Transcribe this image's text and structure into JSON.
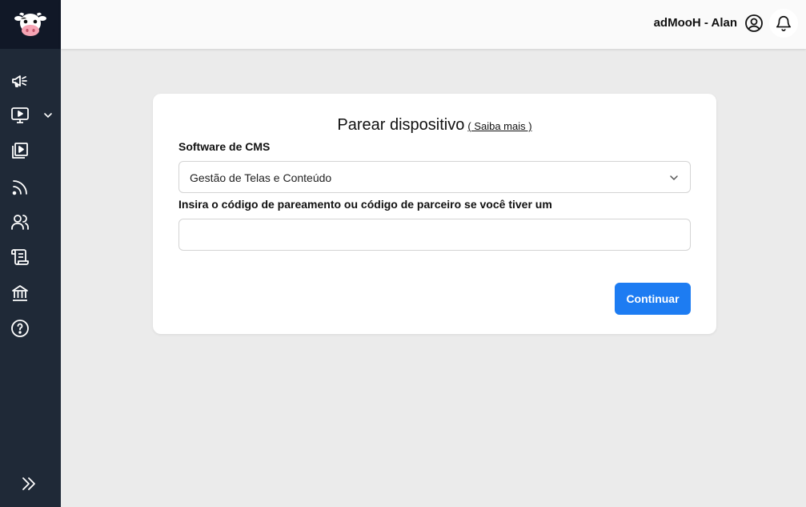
{
  "header": {
    "user_name": "adMooH - Alan"
  },
  "sidebar": {
    "logo_icon": "cow-logo-icon",
    "items": [
      {
        "icon": "megaphone-icon"
      },
      {
        "icon": "monitor-play-icon",
        "has_submenu": true
      },
      {
        "icon": "playlist-video-icon"
      },
      {
        "icon": "rss-feed-icon"
      },
      {
        "icon": "users-icon"
      },
      {
        "icon": "scroll-icon"
      },
      {
        "icon": "bank-icon"
      },
      {
        "icon": "help-circle-icon"
      }
    ],
    "expand_icon": "chevrons-right-icon"
  },
  "form": {
    "title": "Parear dispositivo",
    "learn_more": "( Saiba mais )",
    "cms_label": "Software de CMS",
    "cms_selected": "Gestão de Telas e Conteúdo",
    "code_label": "Insira o código de pareamento ou código de parceiro se você tiver um",
    "code_value": "",
    "code_placeholder": "",
    "submit_label": "Continuar"
  },
  "colors": {
    "sidebar_bg": "#1f2937",
    "logo_bg": "#111827",
    "page_bg": "#ebebeb",
    "primary": "#1d7cf2"
  }
}
